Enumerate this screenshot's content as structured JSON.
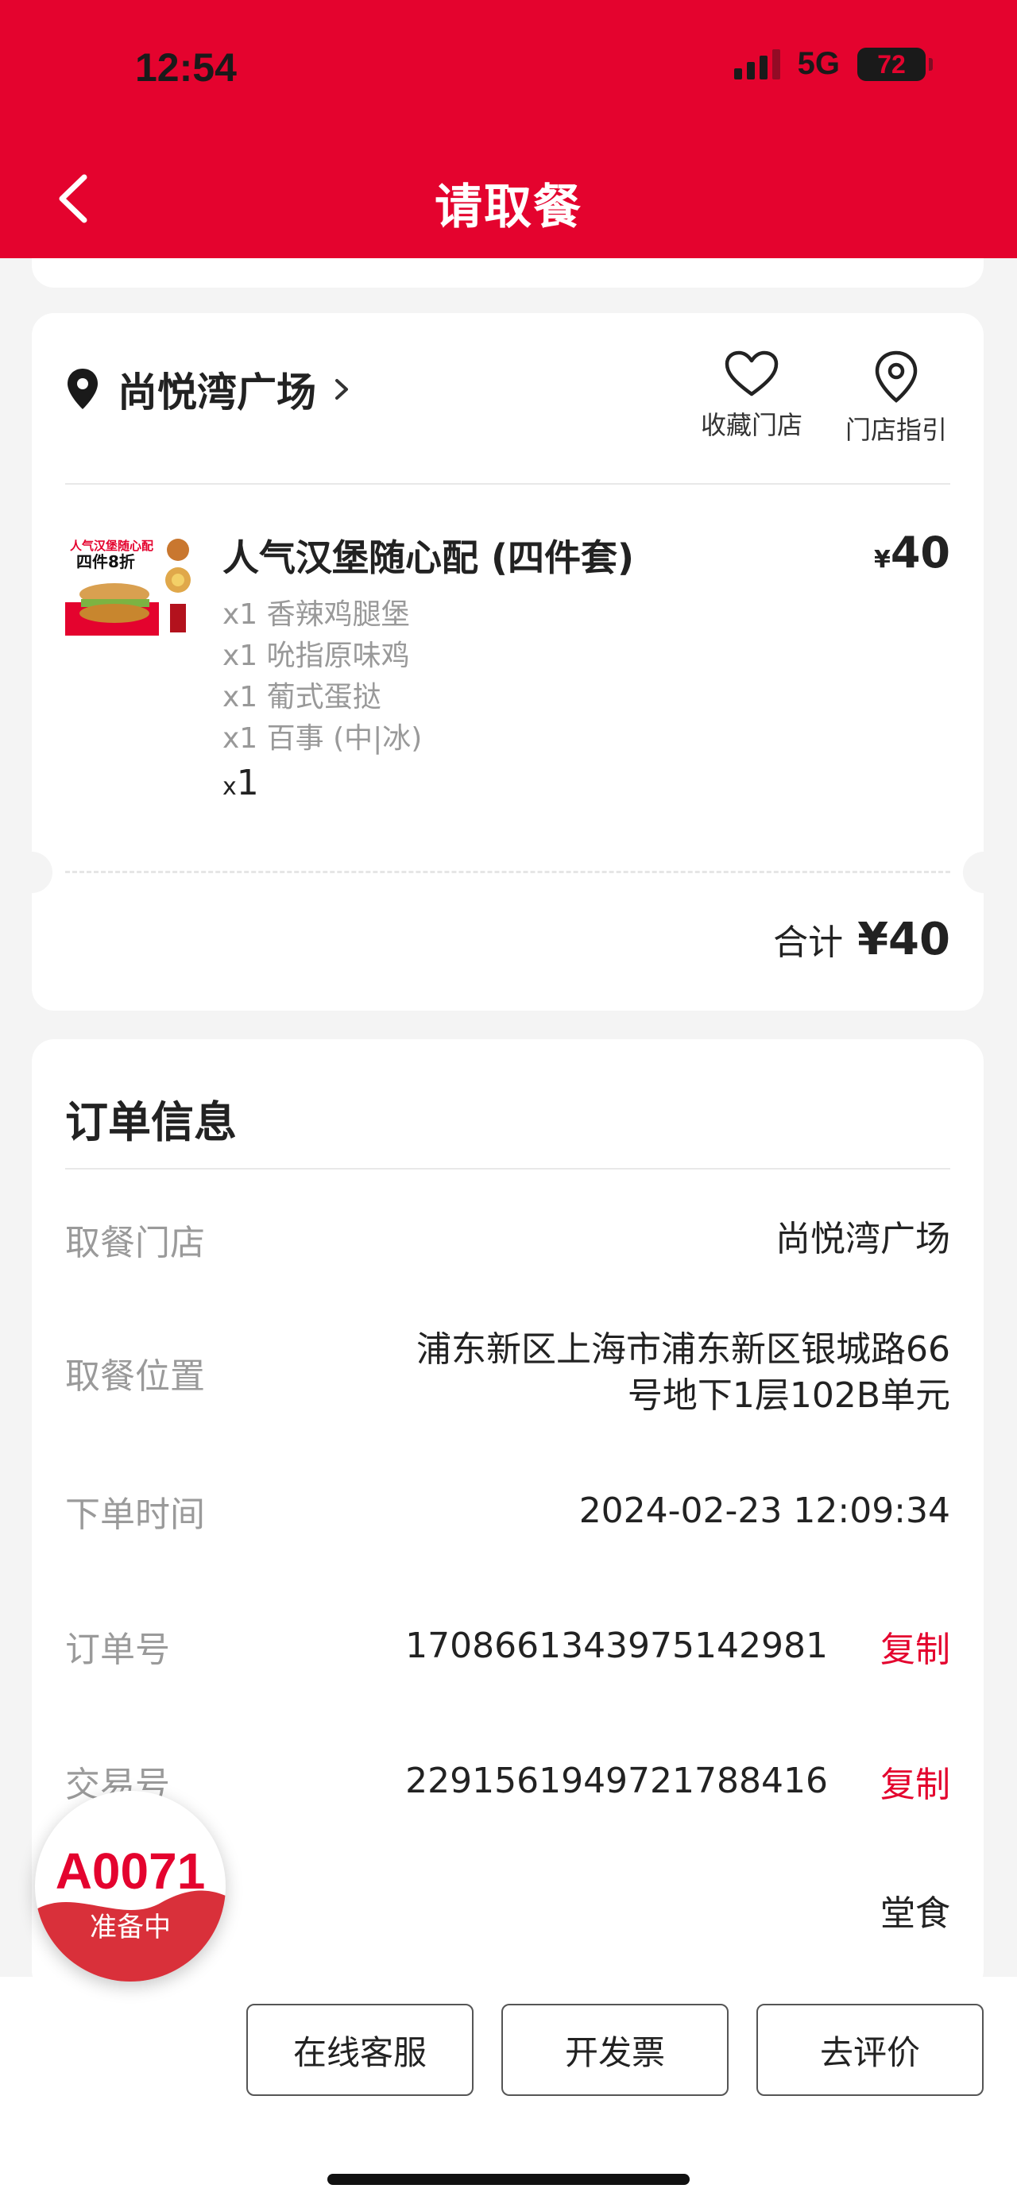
{
  "status_bar": {
    "time": "12:54",
    "network": "5G",
    "battery": "72"
  },
  "header": {
    "title": "请取餐"
  },
  "store": {
    "name": "尚悦湾广场",
    "actions": [
      {
        "label": "收藏门店",
        "icon": "heart-icon"
      },
      {
        "label": "门店指引",
        "icon": "map-pin-icon"
      }
    ]
  },
  "product": {
    "image_text": [
      "人气汉堡随心配",
      "四件8折"
    ],
    "title": "人气汉堡随心配 (四件套)",
    "price_symbol": "¥",
    "price": "40",
    "items": [
      "x1 香辣鸡腿堡",
      "x1 吮指原味鸡",
      "x1 葡式蛋挞",
      "x1 百事 (中|冰)"
    ],
    "qty_prefix": "x",
    "qty": "1"
  },
  "total": {
    "label": "合计",
    "value": "¥40"
  },
  "order_info": {
    "title": "订单信息",
    "rows": [
      {
        "label": "取餐门店",
        "value": "尚悦湾广场"
      },
      {
        "label": "取餐位置",
        "value_lines": [
          "浦东新区上海市浦东新区银城路66",
          "号地下1层102B单元"
        ]
      },
      {
        "label": "下单时间",
        "value": "2024-02-23 12:09:34"
      },
      {
        "label": "订单号",
        "value": "1708661343975142981",
        "action": "复制"
      },
      {
        "label": "交易号",
        "value": "2291561949721788416",
        "action": "复制"
      },
      {
        "label": "",
        "value": "堂食"
      }
    ]
  },
  "pickup_badge": {
    "code": "A0071",
    "status": "准备中"
  },
  "bottom_buttons": [
    "在线客服",
    "开发票",
    "去评价"
  ],
  "colors": {
    "brand_red": "#e4032e",
    "background": "#f4f4f4",
    "muted_text": "#9a9a9a"
  }
}
